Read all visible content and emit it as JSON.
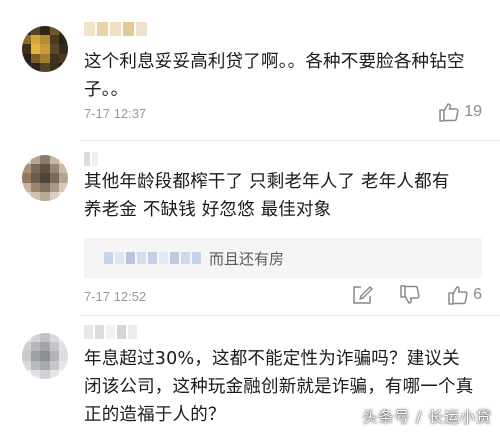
{
  "comments": [
    {
      "text_line1": "这个利息妥妥高利贷了啊。。各种不要脸各种钻空",
      "text_line2": "子。。",
      "time": "7-17 12:37",
      "likes": "19"
    },
    {
      "text_line1": "其他年龄段都榨干了 只剩老年人了 老年人都有",
      "text_line2": "养老金 不缺钱 好忽悠 最佳对象",
      "reply": "而且还有房",
      "time": "7-17 12:52",
      "likes": "6"
    },
    {
      "text_line1": "年息超过30%，这都不能定性为诈骗吗？建议关",
      "text_line2": "闭该公司，这种玩金融创新就是诈骗，有哪一个真",
      "text_line3": "正的造福于人的？"
    }
  ],
  "watermark": "头条号 / 长运小贷",
  "icons": {
    "edit": "edit-icon",
    "dislike": "thumbs-down-icon",
    "like": "thumbs-up-icon"
  },
  "colors": {
    "text": "#1a1a1a",
    "meta": "#9a9a9a",
    "divider": "#e6e6e6",
    "reply_bg": "#f5f5f5"
  }
}
